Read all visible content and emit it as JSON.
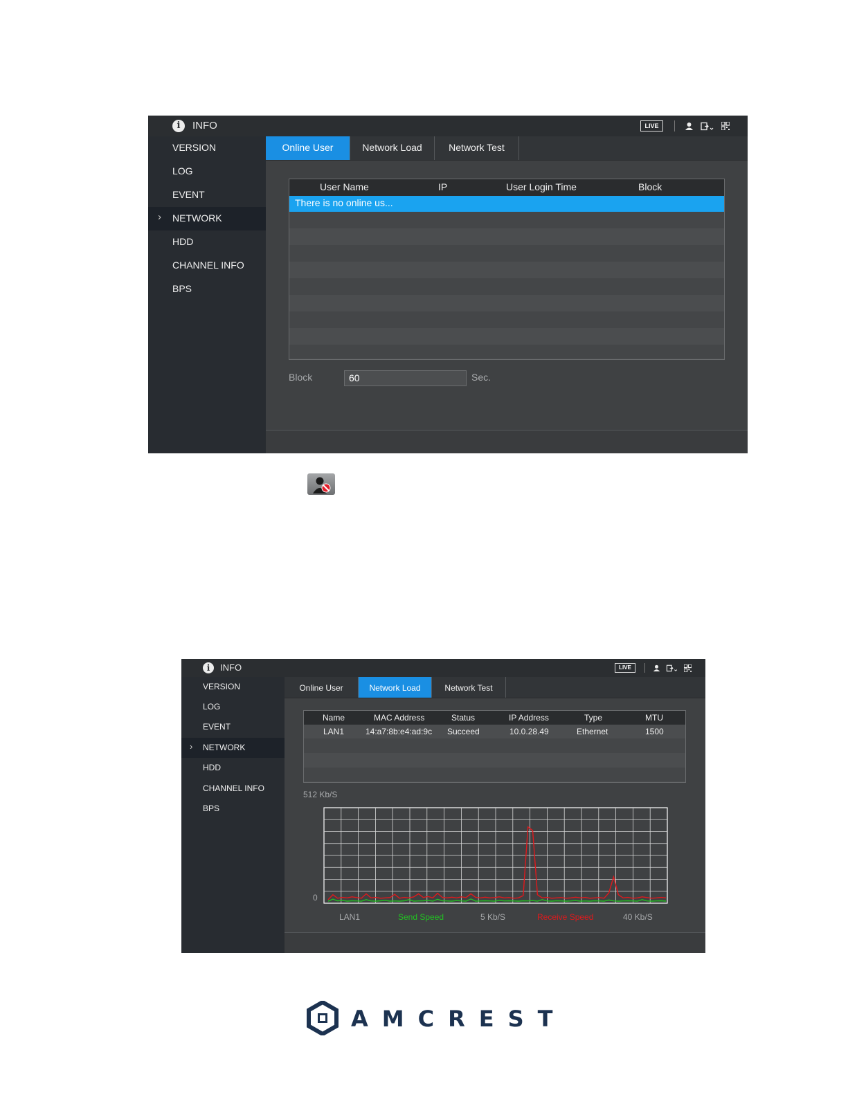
{
  "top": {
    "title": "INFO",
    "live_label": "LIVE",
    "sidebar": [
      "VERSION",
      "LOG",
      "EVENT",
      "NETWORK",
      "HDD",
      "CHANNEL INFO",
      "BPS"
    ],
    "active_sidebar": "NETWORK",
    "chevron": "›",
    "tabs": [
      "Online User",
      "Network Load",
      "Network Test"
    ],
    "active_tab": "Online User",
    "table": {
      "headers": [
        "User Name",
        "IP",
        "User Login Time",
        "Block"
      ],
      "selected_row": "There is no online us..."
    },
    "block_label": "Block",
    "block_value": "60",
    "block_unit": "Sec."
  },
  "bottom": {
    "title": "INFO",
    "live_label": "LIVE",
    "sidebar": [
      "VERSION",
      "LOG",
      "EVENT",
      "NETWORK",
      "HDD",
      "CHANNEL INFO",
      "BPS"
    ],
    "active_sidebar": "NETWORK",
    "chevron": "›",
    "tabs": [
      "Online User",
      "Network Load",
      "Network Test"
    ],
    "active_tab": "Network Load",
    "table": {
      "headers": [
        "Name",
        "MAC Address",
        "Status",
        "IP Address",
        "Type",
        "MTU"
      ],
      "rows": [
        [
          "LAN1",
          "14:a7:8b:e4:ad:9c",
          "Succeed",
          "10.0.28.49",
          "Ethernet",
          "1500"
        ]
      ]
    },
    "chart_data": {
      "type": "line",
      "ymax_label": "512 Kb/S",
      "ymin_label": "0",
      "ylim": [
        0,
        512
      ],
      "grid": true,
      "series": [
        {
          "name": "Send Speed",
          "color": "#22c022",
          "values": [
            3,
            15,
            5,
            8,
            4,
            6,
            5,
            4,
            12,
            5,
            4,
            6,
            8,
            4,
            5,
            4,
            6,
            12,
            4,
            5,
            6,
            8,
            4,
            14,
            6,
            5,
            4,
            7,
            5,
            4,
            16,
            4,
            5,
            6,
            5,
            4,
            8,
            5,
            6,
            5,
            4,
            6,
            5,
            7,
            4,
            12,
            5,
            4,
            6,
            5,
            4,
            5,
            7,
            4,
            5,
            4,
            6,
            5,
            4,
            10,
            5,
            4,
            5,
            6,
            5,
            4,
            12,
            5,
            4,
            5,
            6,
            4
          ]
        },
        {
          "name": "Receive Speed",
          "color": "#e0191c",
          "values": [
            12,
            40,
            20,
            25,
            22,
            28,
            24,
            20,
            45,
            22,
            25,
            20,
            22,
            24,
            42,
            20,
            25,
            22,
            28,
            45,
            24,
            30,
            22,
            48,
            25,
            22,
            26,
            22,
            28,
            24,
            45,
            25,
            22,
            26,
            22,
            24,
            28,
            22,
            24,
            20,
            22,
            35,
            420,
            400,
            40,
            22,
            25,
            20,
            22,
            24,
            20,
            22,
            26,
            22,
            25,
            20,
            22,
            24,
            20,
            50,
            140,
            40,
            22,
            25,
            20,
            22,
            28,
            24,
            20,
            22,
            25,
            22
          ]
        }
      ],
      "legend": [
        {
          "text": "LAN1",
          "color": "#a8aaac"
        },
        {
          "text": "Send Speed",
          "color": "#22c022"
        },
        {
          "text": "5 Kb/S",
          "color": "#a8aaac"
        },
        {
          "text": "Receive Speed",
          "color": "#e0191c"
        },
        {
          "text": "40 Kb/S",
          "color": "#a8aaac"
        }
      ]
    }
  },
  "brand": {
    "name": "AMCREST"
  }
}
